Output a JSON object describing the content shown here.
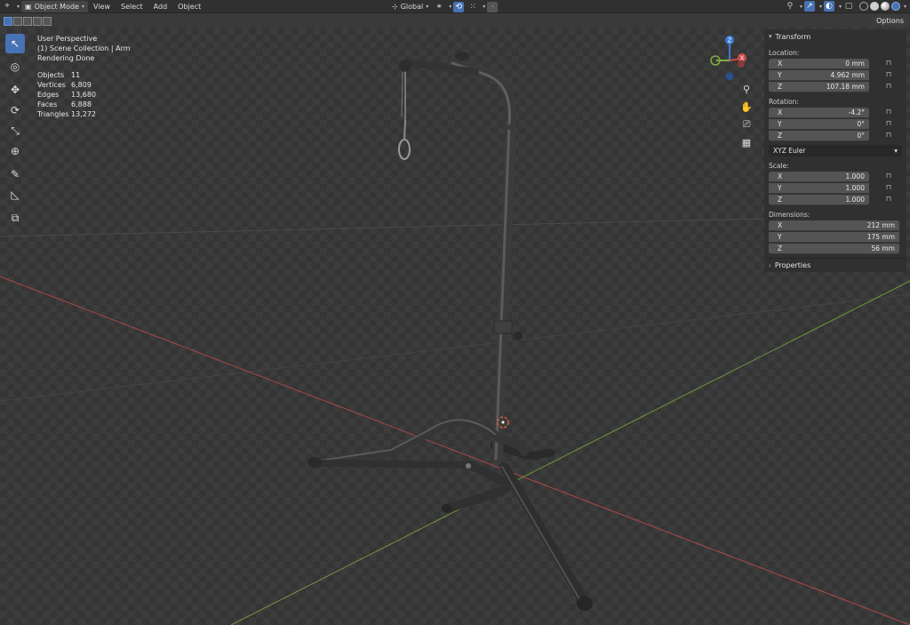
{
  "header": {
    "mode": "Object Mode",
    "menus": [
      "View",
      "Select",
      "Add",
      "Object"
    ],
    "orientation": "Global",
    "options_label": "Options"
  },
  "overlay": {
    "view_name": "User Perspective",
    "collection": "(1) Scene Collection | Arm",
    "status": "Rendering Done",
    "stats": [
      {
        "label": "Objects",
        "value": "11"
      },
      {
        "label": "Vertices",
        "value": "6,809"
      },
      {
        "label": "Edges",
        "value": "13,680"
      },
      {
        "label": "Faces",
        "value": "6,888"
      },
      {
        "label": "Triangles",
        "value": "13,272"
      }
    ]
  },
  "gizmo": {
    "x": "X",
    "y": "Y",
    "z": "Z"
  },
  "npanel": {
    "transform_title": "Transform",
    "location_label": "Location:",
    "location": [
      {
        "axis": "X",
        "value": "0 mm"
      },
      {
        "axis": "Y",
        "value": "4.962 mm"
      },
      {
        "axis": "Z",
        "value": "107.18 mm"
      }
    ],
    "rotation_label": "Rotation:",
    "rotation": [
      {
        "axis": "X",
        "value": "-4.2°"
      },
      {
        "axis": "Y",
        "value": "0°"
      },
      {
        "axis": "Z",
        "value": "0°"
      }
    ],
    "rotation_mode": "XYZ Euler",
    "scale_label": "Scale:",
    "scale": [
      {
        "axis": "X",
        "value": "1.000"
      },
      {
        "axis": "Y",
        "value": "1.000"
      },
      {
        "axis": "Z",
        "value": "1.000"
      }
    ],
    "dimensions_label": "Dimensions:",
    "dimensions": [
      {
        "axis": "X",
        "value": "212 mm"
      },
      {
        "axis": "Y",
        "value": "175 mm"
      },
      {
        "axis": "Z",
        "value": "56 mm"
      }
    ],
    "properties_title": "Properties"
  },
  "colors": {
    "accent": "#4772b3",
    "x_axis": "#c94b4b",
    "y_axis": "#7fae3b",
    "z_axis": "#3d7bd6"
  }
}
